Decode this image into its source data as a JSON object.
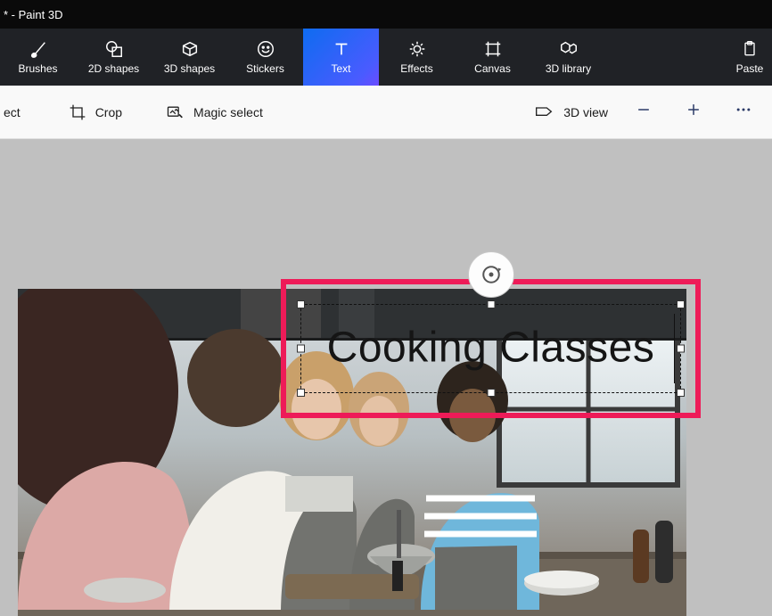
{
  "window": {
    "title": "* - Paint 3D"
  },
  "toolbar": {
    "brushes": "Brushes",
    "shapes2d": "2D shapes",
    "shapes3d": "3D shapes",
    "stickers": "Stickers",
    "text": "Text",
    "effects": "Effects",
    "canvas": "Canvas",
    "library3d": "3D library",
    "paste": "Paste"
  },
  "secondary": {
    "select": "ect",
    "crop": "Crop",
    "magic_select": "Magic select",
    "view3d": "3D view"
  },
  "canvas": {
    "text_content": "Cooking Classes"
  }
}
